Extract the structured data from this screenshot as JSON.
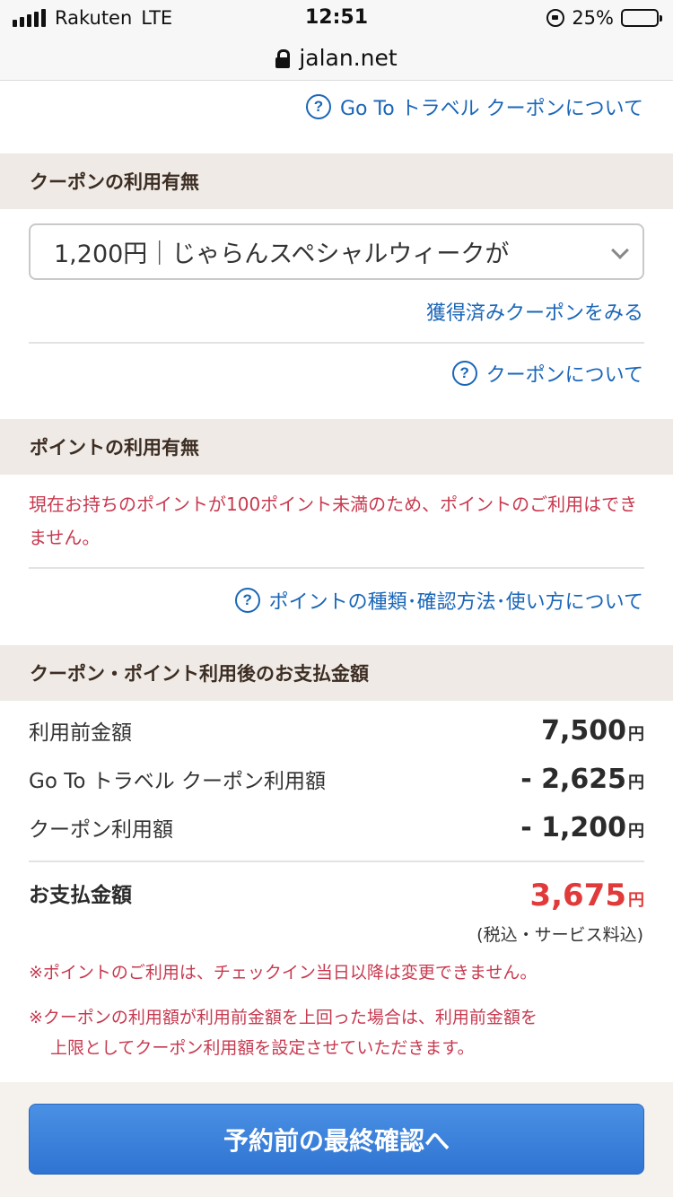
{
  "status_bar": {
    "carrier": "Rakuten",
    "network": "LTE",
    "time": "12:51",
    "battery_text": "25%",
    "battery_level": 0.25
  },
  "url_bar": {
    "url": "jalan.net"
  },
  "goto_link": {
    "icon": "question-circle-icon",
    "text": "Go To トラベル クーポンについて"
  },
  "coupon_section": {
    "heading": "クーポンの利用有無",
    "select_value": "1,200円｜じゃらんスペシャルウィークが",
    "acquired_link": "獲得済みクーポンをみる",
    "about_link": "クーポンについて"
  },
  "point_section": {
    "heading": "ポイントの利用有無",
    "notice": "現在お持ちのポイントが100ポイント未満のため、ポイントのご利用はできません。",
    "about_link": "ポイントの種類･確認方法･使い方について"
  },
  "payment_section": {
    "heading": "クーポン・ポイント利用後のお支払金額",
    "rows": [
      {
        "label": "利用前金額",
        "value": "7,500",
        "unit": "円"
      },
      {
        "label": "Go To トラベル クーポン利用額",
        "value": "- 2,625",
        "unit": "円"
      },
      {
        "label": "クーポン利用額",
        "value": "- 1,200",
        "unit": "円"
      }
    ],
    "total_label": "お支払金額",
    "total_value": "3,675",
    "total_unit": "円",
    "tax_note": "(税込・サービス料込)",
    "note1": "※ポイントのご利用は、チェックイン当日以降は変更できません。",
    "note2_line1": "※クーポンの利用額が利用前金額を上回った場合は、利用前金額を",
    "note2_line2": "上限としてクーポン利用額を設定させていただきます。"
  },
  "confirm_button": {
    "label": "予約前の最終確認へ"
  },
  "colors": {
    "link": "#1a66b8",
    "warning": "#c8394f",
    "total": "#e03a3a",
    "section_bg": "#efeae5",
    "button": "#3a80db"
  }
}
